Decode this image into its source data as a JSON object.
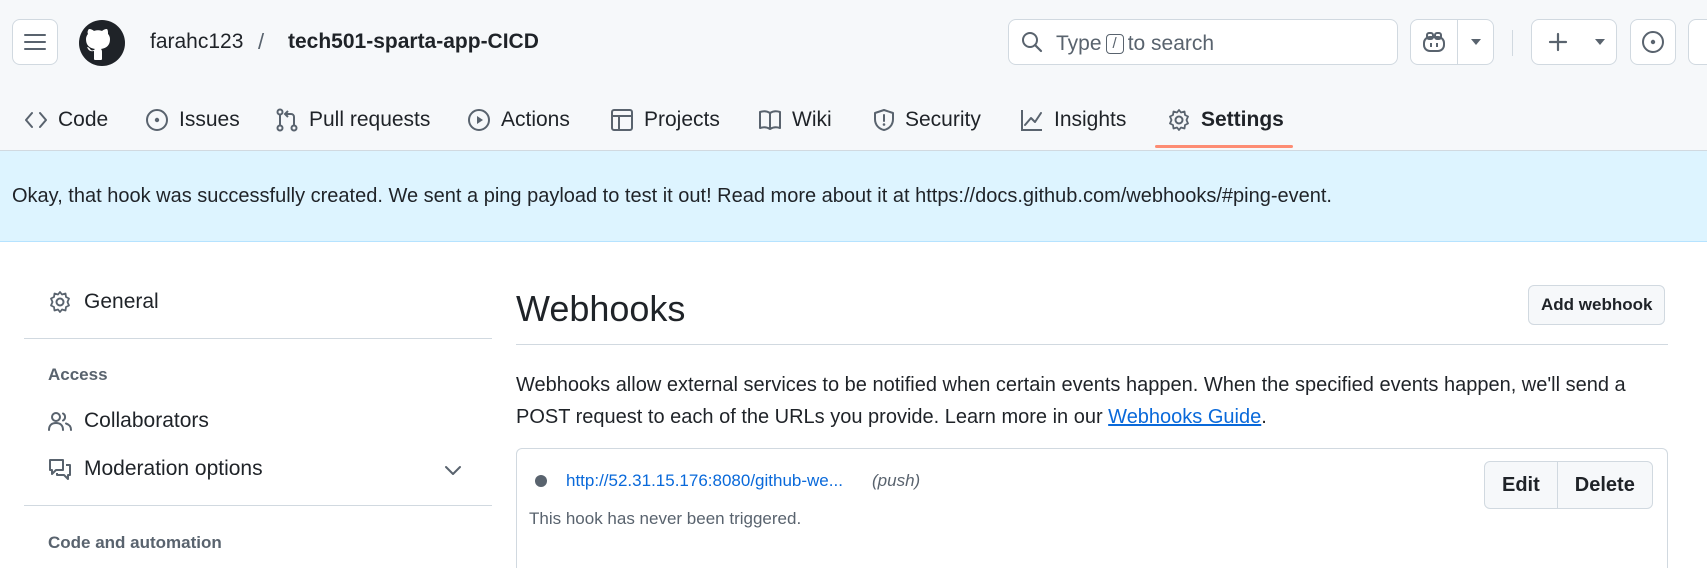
{
  "header": {
    "owner": "farahc123",
    "separator": "/",
    "repo": "tech501-sparta-app-CICD",
    "search": {
      "before": "Type",
      "key": "/",
      "after": "to search"
    }
  },
  "tabs": [
    {
      "label": "Code",
      "icon": "code-icon"
    },
    {
      "label": "Issues",
      "icon": "issue-icon"
    },
    {
      "label": "Pull requests",
      "icon": "pull-request-icon"
    },
    {
      "label": "Actions",
      "icon": "play-icon"
    },
    {
      "label": "Projects",
      "icon": "table-icon"
    },
    {
      "label": "Wiki",
      "icon": "book-icon"
    },
    {
      "label": "Security",
      "icon": "shield-icon"
    },
    {
      "label": "Insights",
      "icon": "graph-icon"
    },
    {
      "label": "Settings",
      "icon": "gear-icon",
      "selected": true
    }
  ],
  "flash": {
    "message": "Okay, that hook was successfully created. We sent a ping payload to test it out! Read more about it at https://docs.github.com/webhooks/#ping-event."
  },
  "sidebar": {
    "general": "General",
    "access_heading": "Access",
    "collaborators": "Collaborators",
    "moderation": "Moderation options",
    "code_heading": "Code and automation"
  },
  "main": {
    "title": "Webhooks",
    "add_button": "Add webhook",
    "desc_text": "Webhooks allow external services to be notified when certain events happen. When the specified events happen, we'll send a POST request to each of the URLs you provide. Learn more in our ",
    "desc_link": "Webhooks Guide",
    "desc_end": ".",
    "hook": {
      "url": "http://52.31.15.176:8080/github-we...",
      "events": "(push)",
      "status": "This hook has never been triggered.",
      "edit_label": "Edit",
      "delete_label": "Delete"
    }
  },
  "colors": {
    "accent": "#0969da",
    "flash_bg": "#ddf4ff",
    "tab_underline": "#fd8c73",
    "header_bg": "#f6f8fa"
  }
}
